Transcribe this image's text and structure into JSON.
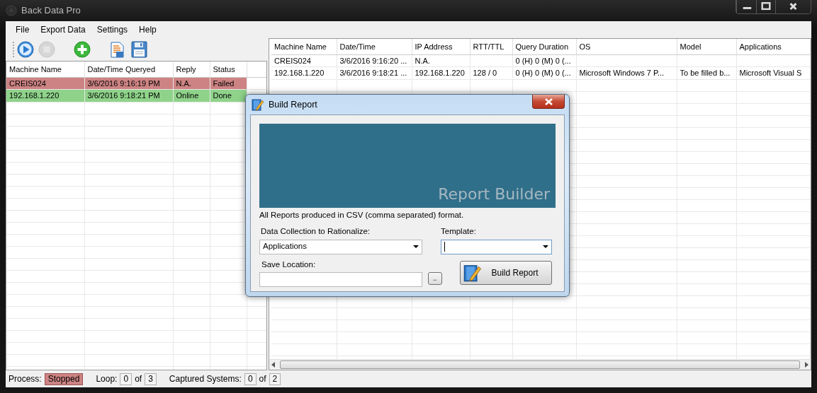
{
  "window": {
    "title": "Back Data Pro"
  },
  "menu": [
    "File",
    "Export Data",
    "Settings",
    "Help"
  ],
  "toolbar": [
    {
      "kind": "play",
      "disabled": false
    },
    {
      "kind": "stop",
      "disabled": true
    },
    {
      "kind": "add",
      "disabled": false
    },
    {
      "kind": "report",
      "disabled": false
    },
    {
      "kind": "save",
      "disabled": false
    }
  ],
  "query_list": {
    "columns": [
      "Machine Name",
      "Date/Time Queryed",
      "Reply",
      "Status"
    ],
    "rows": [
      {
        "cells": [
          "CREIS024",
          "3/6/2016 9:16:19 PM",
          "N.A.",
          "Failed"
        ],
        "color": "#cd8383"
      },
      {
        "cells": [
          "192.168.1.220",
          "3/6/2016 9:18:21 PM",
          "Online",
          "Done"
        ],
        "color": "#8fd38a"
      }
    ]
  },
  "results_table": {
    "columns": [
      "Machine Name",
      "Date/Time",
      "IP Address",
      "RTT/TTL",
      "Query Duration",
      "OS",
      "Model",
      "Applications"
    ],
    "rows": [
      [
        "CREIS024",
        "3/6/2016 9:16:20 ...",
        "N.A.",
        "",
        "0 (H) 0 (M) 0 (...",
        "",
        "",
        ""
      ],
      [
        "192.168.1.220",
        "3/6/2016 9:18:21 ...",
        "192.168.1.220",
        "128 / 0",
        "0 (H) 0 (M) 0 (...",
        "Microsoft Windows 7 P...",
        "To be filled b...",
        "Microsoft Visual S"
      ]
    ]
  },
  "dialog": {
    "title": "Build Report",
    "banner": "Report Builder",
    "note": "All Reports produced in CSV (comma separated) format.",
    "collection_label": "Data Collection to Rationalize:",
    "collection_value": "Applications",
    "template_label": "Template:",
    "template_focused": true,
    "save_label": "Save Location:",
    "browse_button": "..",
    "build_button": "Build Report"
  },
  "status_bar": {
    "process_label": "Process:",
    "process_value": "Stopped",
    "loop_label": "Loop:",
    "loop_value": "0",
    "loop_of": "of",
    "loop_total": "3",
    "captured_label": "Captured Systems:",
    "captured_value": "0",
    "captured_of": "of",
    "captured_total": "2"
  }
}
